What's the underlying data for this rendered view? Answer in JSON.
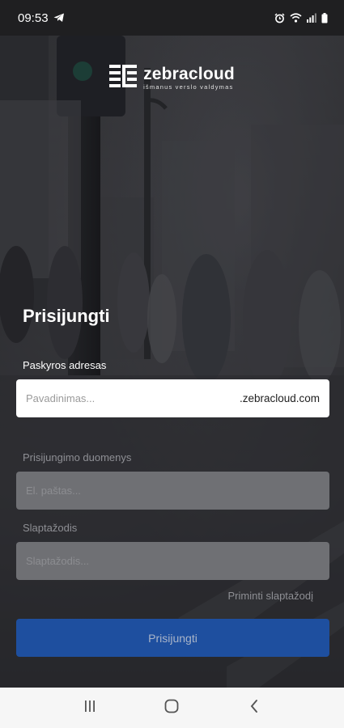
{
  "status": {
    "time": "09:53"
  },
  "logo": {
    "name": "zebracloud",
    "tagline": "išmanus verslo valdymas"
  },
  "form": {
    "title": "Prisijungti",
    "account_label": "Paskyros adresas",
    "account_placeholder": "Pavadinimas...",
    "account_suffix": ".zebracloud.com",
    "credentials_label": "Prisijungimo duomenys",
    "email_placeholder": "El. paštas...",
    "password_label": "Slaptažodis",
    "password_placeholder": "Slaptažodis...",
    "remind_link": "Priminti slaptažodį",
    "submit_label": "Prisijungti"
  },
  "colors": {
    "button": "#1e4f9f",
    "disabled_field": "#6f7074"
  },
  "icons": {
    "status": [
      "telegram-icon",
      "alarm-icon",
      "wifi-icon",
      "signal-icon",
      "battery-icon"
    ],
    "nav": [
      "recent-apps-icon",
      "home-icon",
      "back-icon"
    ]
  }
}
